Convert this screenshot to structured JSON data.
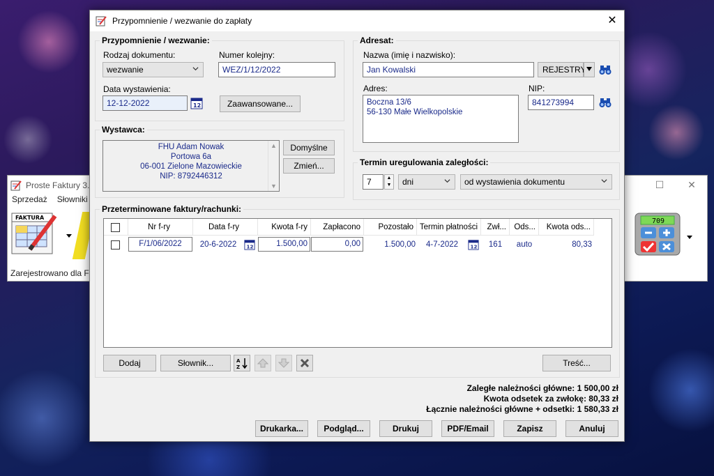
{
  "background_app": {
    "title": "Proste Faktury 3.8",
    "menu": [
      "Sprzedaż",
      "Słowniki"
    ],
    "registered_text": "Zarejestrowano dla F",
    "tile_label": "FAKTURA"
  },
  "dialog": {
    "title": "Przypomnienie / wezwanie do zapłaty",
    "reminder_group": {
      "title": "Przypomnienie / wezwanie:",
      "doc_type_label": "Rodzaj dokumentu:",
      "doc_type_value": "wezwanie",
      "number_label": "Numer kolejny:",
      "number_value": "WEZ/1/12/2022",
      "issue_date_label": "Data wystawienia:",
      "issue_date_value": "12-12-2022",
      "advanced_button": "Zaawansowane..."
    },
    "issuer_group": {
      "title": "Wystawca:",
      "lines": [
        "FHU Adam Nowak",
        "Portowa 6a",
        "06-001 Zielone Mazowieckie",
        "NIP: 8792446312"
      ],
      "default_button": "Domyślne",
      "change_button": "Zmień..."
    },
    "addressee_group": {
      "title": "Adresat:",
      "name_label": "Nazwa (imię i nazwisko):",
      "name_value": "Jan Kowalski",
      "registers_button": "REJESTRY",
      "address_label": "Adres:",
      "address_lines": [
        "Boczna 13/6",
        "56-130 Małe Wielkopolskie"
      ],
      "nip_label": "NIP:",
      "nip_value": "841273994"
    },
    "term_group": {
      "title": "Termin uregulowania zaległości:",
      "days_value": "7",
      "unit_value": "dni",
      "from_value": "od wystawienia dokumentu"
    },
    "invoices_group": {
      "title": "Przeterminowane faktury/rachunki:",
      "columns": [
        "Nr f-ry",
        "Data f-ry",
        "Kwota f-ry",
        "Zapłacono",
        "Pozostało",
        "Termin płatności",
        "Zwł...",
        "Ods...",
        "Kwota ods..."
      ],
      "rows": [
        {
          "nr": "F/1/06/2022",
          "date": "20-6-2022",
          "amount": "1.500,00",
          "paid": "0,00",
          "remaining": "1.500,00",
          "due": "4-7-2022",
          "delay": "161",
          "interest_type": "auto",
          "interest": "80,33"
        }
      ],
      "add_button": "Dodaj",
      "dictionary_button": "Słownik...",
      "content_button": "Treść..."
    },
    "summary": {
      "principal": "Zaległe należności główne: 1 500,00 zł",
      "interest": "Kwota odsetek za zwłokę: 80,33 zł",
      "total": "Łącznie należności główne + odsetki: 1 580,33 zł"
    },
    "footer_buttons": {
      "printer": "Drukarka...",
      "preview": "Podgląd...",
      "print": "Drukuj",
      "pdf": "PDF/Email",
      "save": "Zapisz",
      "cancel": "Anuluj"
    }
  }
}
